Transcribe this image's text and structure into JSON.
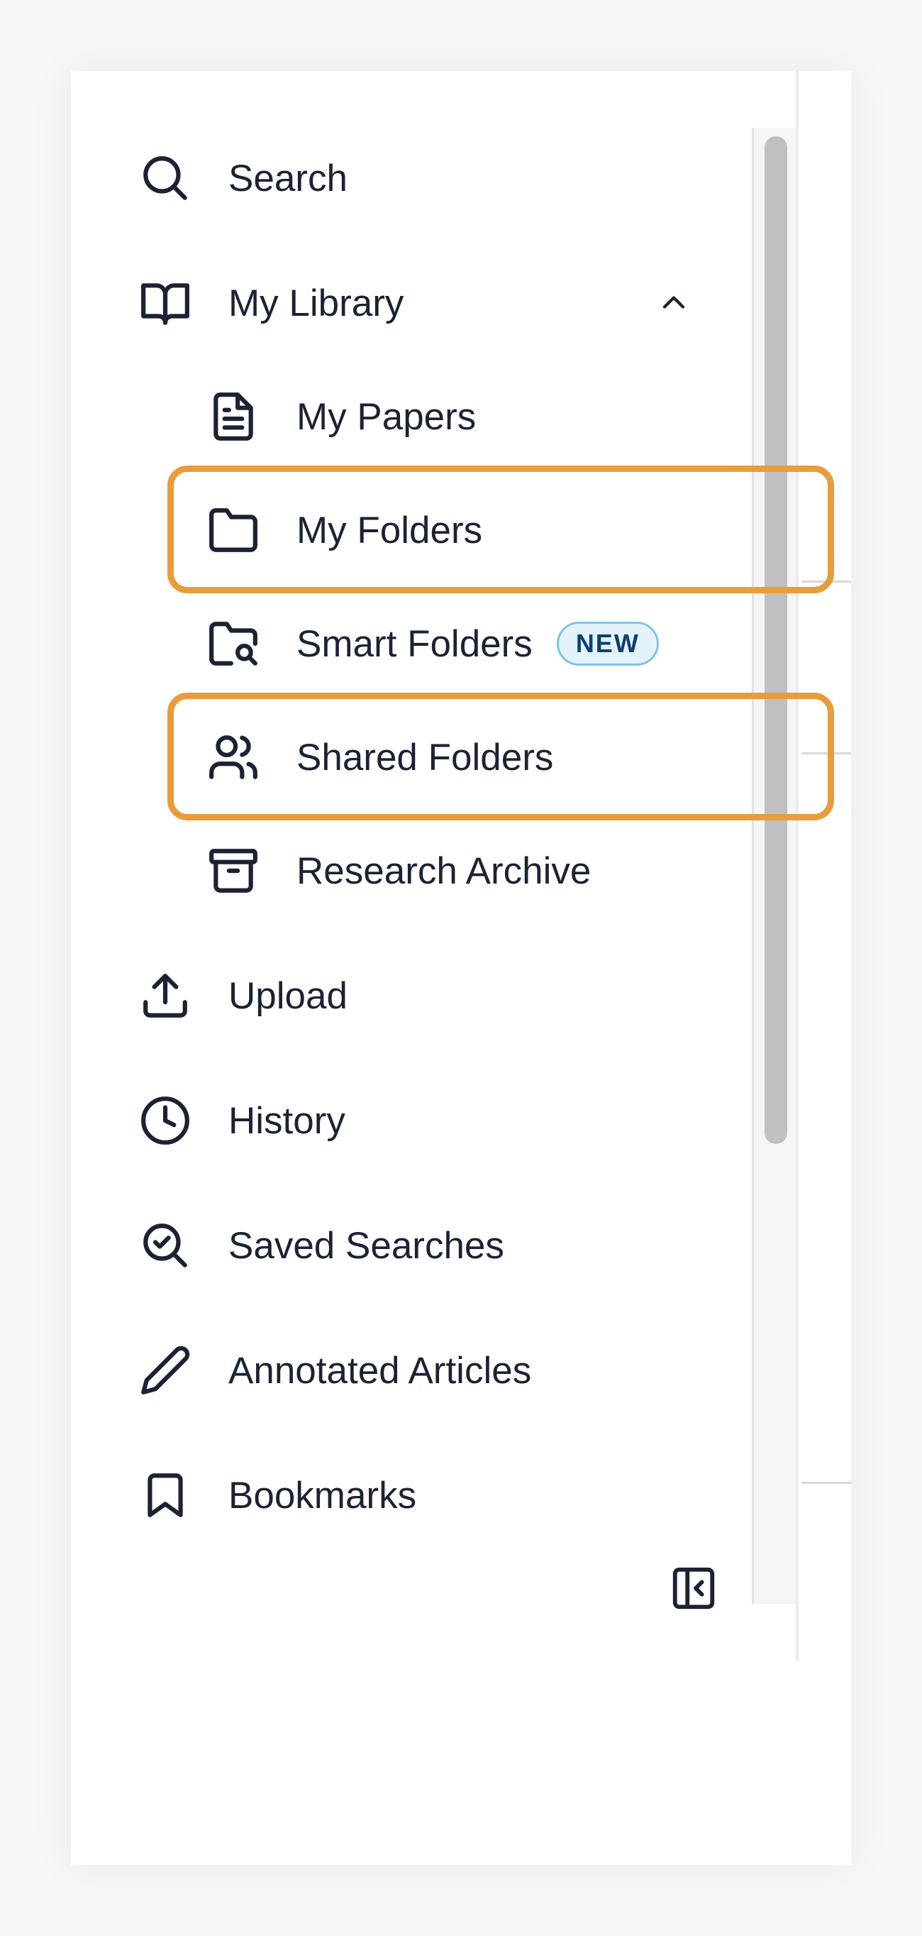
{
  "nav": {
    "search": {
      "label": "Search",
      "icon": "search-icon"
    },
    "library": {
      "label": "My Library",
      "icon": "book-open-icon",
      "expanded": true
    },
    "library_items": [
      {
        "label": "My Papers",
        "icon": "file-text-icon"
      },
      {
        "label": "My Folders",
        "icon": "folder-icon"
      },
      {
        "label": "Smart Folders",
        "icon": "folder-search-icon",
        "badge": "NEW"
      },
      {
        "label": "Shared Folders",
        "icon": "users-icon"
      },
      {
        "label": "Research Archive",
        "icon": "archive-icon"
      }
    ],
    "upload": {
      "label": "Upload",
      "icon": "upload-icon"
    },
    "history": {
      "label": "History",
      "icon": "clock-icon"
    },
    "saved_searches": {
      "label": "Saved Searches",
      "icon": "search-check-icon"
    },
    "annotated": {
      "label": "Annotated Articles",
      "icon": "pencil-icon"
    },
    "bookmarks": {
      "label": "Bookmarks",
      "icon": "bookmark-icon"
    }
  },
  "colors": {
    "highlight": "#e89c3a",
    "badge_bg": "#e4f3fb",
    "badge_border": "#7cc4e4",
    "badge_text": "#0e3f70",
    "text": "#1b2233"
  }
}
